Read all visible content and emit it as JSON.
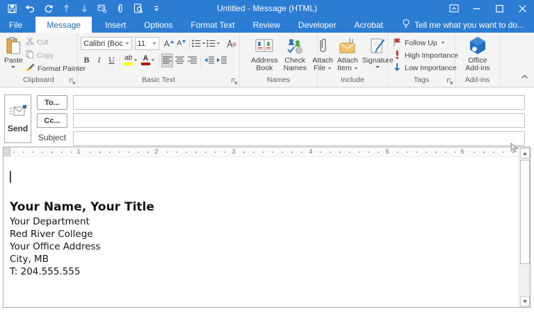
{
  "window": {
    "title": "Untitled - Message (HTML)"
  },
  "quick_access": {
    "icons": [
      "save-icon",
      "undo-icon",
      "redo-icon",
      "previous-item-icon",
      "next-item-icon",
      "select-names-icon",
      "attach-file-icon",
      "print-preview-icon",
      "customize-quick-access-icon"
    ]
  },
  "tabs": [
    {
      "label": "File"
    },
    {
      "label": "Message"
    },
    {
      "label": "Insert"
    },
    {
      "label": "Options"
    },
    {
      "label": "Format Text"
    },
    {
      "label": "Review"
    },
    {
      "label": "Developer"
    },
    {
      "label": "Acrobat"
    }
  ],
  "tell_me": {
    "label": "Tell me what you want to do..."
  },
  "ribbon": {
    "clipboard": {
      "group_label": "Clipboard",
      "paste": "Paste",
      "cut": "Cut",
      "copy": "Copy",
      "format_painter": "Format Painter"
    },
    "basic_text": {
      "group_label": "Basic Text",
      "font_name": "Calibri (Boc",
      "font_size": "11",
      "grow_font": "A",
      "shrink_font": "A",
      "bold": "B",
      "italic": "I",
      "underline": "U",
      "highlight": "ab",
      "font_color": "A"
    },
    "names": {
      "group_label": "Names",
      "address_book_line1": "Address",
      "address_book_line2": "Book",
      "check_names_line1": "Check",
      "check_names_line2": "Names"
    },
    "include": {
      "group_label": "Include",
      "attach_file_line1": "Attach",
      "attach_file_line2": "File",
      "attach_item_line1": "Attach",
      "attach_item_line2": "Item",
      "signature": "Signature"
    },
    "tags": {
      "group_label": "Tags",
      "follow_up": "Follow Up",
      "high_importance": "High Importance",
      "low_importance": "Low Importance"
    },
    "addins": {
      "group_label": "Add-ins",
      "office_addins_line1": "Office",
      "office_addins_line2": "Add-ins"
    }
  },
  "envelope": {
    "send": "Send",
    "to": "To...",
    "cc": "Cc...",
    "subject": "Subject",
    "to_value": "",
    "cc_value": "",
    "subject_value": ""
  },
  "ruler": {
    "numbers": [
      "1",
      "2",
      "3",
      "4",
      "5",
      "6"
    ]
  },
  "message_body": {
    "signature_heading": "Your Name, Your Title",
    "signature_lines": [
      "Your Department",
      "Red River College",
      "Your Office Address",
      "City, MB",
      "T: 204.555.555"
    ]
  },
  "colors": {
    "titlebar_blue": "#2b7cd3",
    "active_tab_text": "#1e66ab",
    "highlight_yellow": "#ffff00",
    "font_color_red": "#c00000",
    "flag_red": "#d13438",
    "importance_red": "#c0392b",
    "low_importance_blue": "#2e75b6",
    "addin_blue": "#2170c5"
  }
}
